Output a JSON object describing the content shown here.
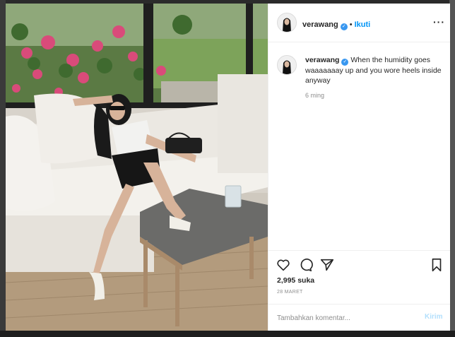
{
  "post": {
    "username": "verawang",
    "verified": true,
    "separator": "•",
    "follow_label": "Ikuti",
    "more_icon": "more-options-icon",
    "caption_text": "When the humidity goes waaaaaaay up and you wore heels inside anyway",
    "caption_time": "6 ming",
    "likes": "2,995 suka",
    "date": "28 MARET",
    "comment_placeholder": "Tambahkan komentar...",
    "post_label": "Kirim"
  },
  "icons": {
    "like": "heart-icon",
    "comment": "comment-icon",
    "share": "share-icon",
    "save": "bookmark-icon",
    "verified": "verified-badge-icon"
  },
  "colors": {
    "accent": "#0095f6",
    "verified": "#3897f0",
    "post_disabled": "#b2dffc",
    "text": "#262626",
    "muted": "#8e8e8e"
  }
}
